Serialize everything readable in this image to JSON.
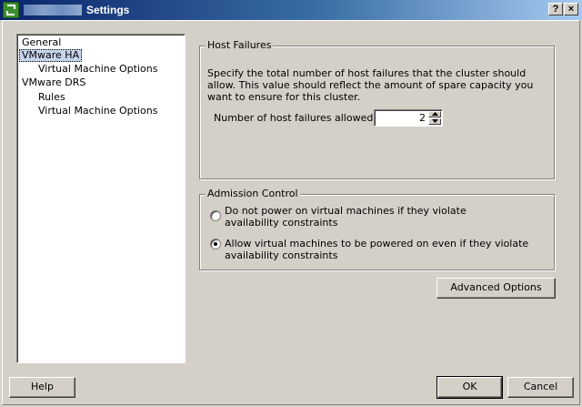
{
  "window": {
    "title": "Settings",
    "help_button": "?",
    "close_button": "×"
  },
  "tree": {
    "items": [
      {
        "label": "General",
        "selected": false
      },
      {
        "label": "VMware HA",
        "selected": true
      },
      {
        "label": "Virtual Machine Options",
        "selected": false
      },
      {
        "label": "VMware DRS",
        "selected": false
      },
      {
        "label": "Rules",
        "selected": false
      },
      {
        "label": "Virtual Machine Options",
        "selected": false
      }
    ]
  },
  "host_failures": {
    "group_label": "Host Failures",
    "description": "Specify the total number of host failures that the cluster should allow.  This value should reflect the amount of spare capacity you want to ensure for this cluster.",
    "field_label": "Number of host failures allowed:",
    "field_value": "2"
  },
  "admission_control": {
    "group_label": "Admission Control",
    "options": [
      {
        "label": "Do not power on virtual machines if they violate availability constraints",
        "selected": false
      },
      {
        "label": "Allow virtual machines to be powered on even if they violate availability constraints",
        "selected": true
      }
    ]
  },
  "buttons": {
    "advanced_options": "Advanced Options",
    "help": "Help",
    "ok": "OK",
    "cancel": "Cancel"
  }
}
